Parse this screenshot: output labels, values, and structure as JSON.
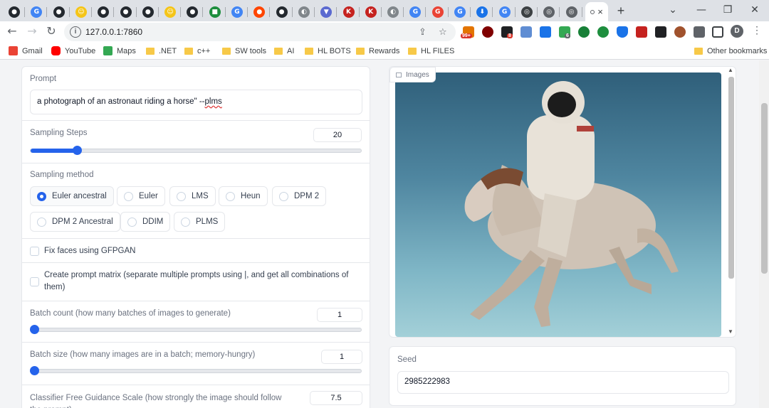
{
  "browser": {
    "tabs": [
      {
        "icon": "github-icon",
        "color": "#24292f",
        "glyph": "●"
      },
      {
        "icon": "google-icon",
        "color": "#4285f4",
        "glyph": "G"
      },
      {
        "icon": "github-icon",
        "color": "#24292f",
        "glyph": "●"
      },
      {
        "icon": "huggingface-icon",
        "color": "#f5c518",
        "glyph": "☺"
      },
      {
        "icon": "github-icon",
        "color": "#24292f",
        "glyph": "●"
      },
      {
        "icon": "github-icon",
        "color": "#24292f",
        "glyph": "●"
      },
      {
        "icon": "github-icon",
        "color": "#24292f",
        "glyph": "●"
      },
      {
        "icon": "huggingface-icon",
        "color": "#f5c518",
        "glyph": "☺"
      },
      {
        "icon": "github-icon",
        "color": "#24292f",
        "glyph": "●"
      },
      {
        "icon": "green-app-icon",
        "color": "#1e8e3e",
        "glyph": "■"
      },
      {
        "icon": "google-icon",
        "color": "#4285f4",
        "glyph": "G"
      },
      {
        "icon": "reddit-icon",
        "color": "#ff4500",
        "glyph": "●"
      },
      {
        "icon": "github-icon",
        "color": "#24292f",
        "glyph": "●"
      },
      {
        "icon": "globe-icon",
        "color": "#80868b",
        "glyph": "◐"
      },
      {
        "icon": "shield-icon",
        "color": "#5b6ad0",
        "glyph": "▼"
      },
      {
        "icon": "k-icon",
        "color": "#c5221f",
        "glyph": "K"
      },
      {
        "icon": "k-icon",
        "color": "#c5221f",
        "glyph": "K"
      },
      {
        "icon": "globe-icon",
        "color": "#80868b",
        "glyph": "◐"
      },
      {
        "icon": "google-icon",
        "color": "#4285f4",
        "glyph": "G"
      },
      {
        "icon": "google-icon",
        "color": "#ea4335",
        "glyph": "G"
      },
      {
        "icon": "google-icon",
        "color": "#4285f4",
        "glyph": "G"
      },
      {
        "icon": "download-icon",
        "color": "#1a73e8",
        "glyph": "⬇"
      },
      {
        "icon": "google-icon",
        "color": "#4285f4",
        "glyph": "G"
      },
      {
        "icon": "web-icon",
        "color": "#3c4043",
        "glyph": "◎"
      },
      {
        "icon": "web-icon",
        "color": "#5f6368",
        "glyph": "◎"
      },
      {
        "icon": "web-icon",
        "color": "#5f6368",
        "glyph": "◎"
      }
    ],
    "active_tab_close": "×",
    "new_tab": "+",
    "url": "127.0.0.1:7860",
    "profile_initial": "D",
    "ext_badges": {
      "first": "99+",
      "second": "8",
      "third": "6"
    },
    "bookmarks": [
      {
        "label": "Gmail",
        "icon": "gmail-icon"
      },
      {
        "label": "YouTube",
        "icon": "youtube-icon"
      },
      {
        "label": "Maps",
        "icon": "maps-icon"
      },
      {
        "label": ".NET",
        "icon": "folder-icon"
      },
      {
        "label": "c++",
        "icon": "folder-icon"
      },
      {
        "label": "SW tools",
        "icon": "folder-icon"
      },
      {
        "label": "AI",
        "icon": "folder-icon"
      },
      {
        "label": "HL BOTS",
        "icon": "folder-icon"
      },
      {
        "label": "Rewards",
        "icon": "folder-icon"
      },
      {
        "label": "HL FILES",
        "icon": "folder-icon"
      }
    ],
    "other_bookmarks": "Other bookmarks"
  },
  "form": {
    "prompt_label": "Prompt",
    "prompt_value_main": "a photograph of an astronaut riding a horse\" --",
    "prompt_value_spell": "plms",
    "steps_label": "Sampling Steps",
    "steps_value": "20",
    "steps_fraction": 0.14,
    "method_label": "Sampling method",
    "methods": [
      "Euler ancestral",
      "Euler",
      "LMS",
      "Heun",
      "DPM 2",
      "DPM 2 Ancestral",
      "DDIM",
      "PLMS"
    ],
    "selected_method": "Euler ancestral",
    "fix_faces_label": "Fix faces using GFPGAN",
    "prompt_matrix_label": "Create prompt matrix (separate multiple prompts using |, and get all combinations of them)",
    "batch_count_label": "Batch count (how many batches of images to generate)",
    "batch_count_value": "1",
    "batch_count_fraction": 0.0,
    "batch_size_label": "Batch size (how many images are in a batch; memory-hungry)",
    "batch_size_value": "1",
    "batch_size_fraction": 0.0,
    "cfg_label": "Classifier Free Guidance Scale (how strongly the image should follow the prompt)",
    "cfg_value": "7.5"
  },
  "output": {
    "images_label": "Images",
    "seed_label": "Seed",
    "seed_value": "2985222983"
  }
}
